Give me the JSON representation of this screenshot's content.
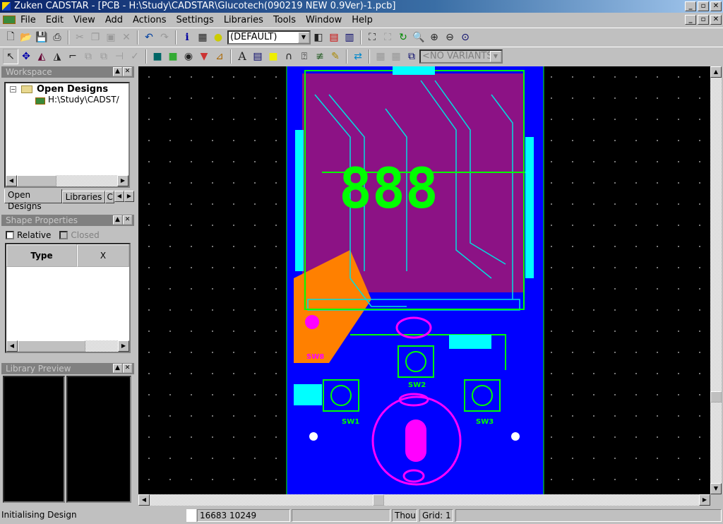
{
  "window": {
    "title": "Zuken CADSTAR - [PCB - H:\\Study\\CADSTAR\\Glucotech(090219 NEW 0.9Ver)-1.pcb]"
  },
  "menu": [
    "File",
    "Edit",
    "View",
    "Add",
    "Actions",
    "Settings",
    "Libraries",
    "Tools",
    "Window",
    "Help"
  ],
  "toolbar": {
    "layer_combo": "(DEFAULT)",
    "variants_combo": "<NO VARIANTS>"
  },
  "workspace": {
    "title": "Workspace",
    "root": "Open Designs",
    "item": "H:\\Study\\CADST/",
    "tabs": [
      "Open Designs",
      "Libraries",
      "C"
    ]
  },
  "shape_properties": {
    "title": "Shape Properties",
    "relative": "Relative",
    "closed": "Closed",
    "col_type": "Type",
    "col_x": "X"
  },
  "library_preview": {
    "title": "Library Preview"
  },
  "board": {
    "display": "888",
    "labels": [
      "SW1",
      "SW2",
      "SW3",
      "SW8"
    ],
    "colors": {
      "board": "#0000ff",
      "copper_top": "#ff3030",
      "copper_bottom": "#00ff00",
      "pads": "#00ffff",
      "silk": "#ff00ff",
      "background": "#000000"
    }
  },
  "status": {
    "message": "Initialising Design",
    "coords": "16683  10249",
    "units": "Thou",
    "grid": "Grid: 1"
  }
}
